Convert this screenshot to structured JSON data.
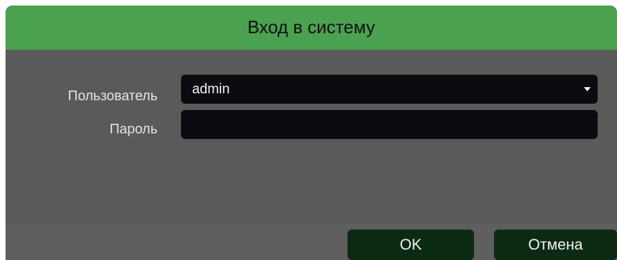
{
  "dialog": {
    "title": "Вход в систему",
    "user_label": "Пользователь",
    "user_value": "admin",
    "password_label": "Пароль",
    "password_value": "",
    "ok_label": "OK",
    "cancel_label": "Отмена"
  },
  "colors": {
    "title_bar": "#4aa14f",
    "panel": "#5a5a5a",
    "field": "#0b0b12",
    "button": "#0c2a12"
  },
  "icons": {
    "dropdown": "chevron-down-icon"
  }
}
